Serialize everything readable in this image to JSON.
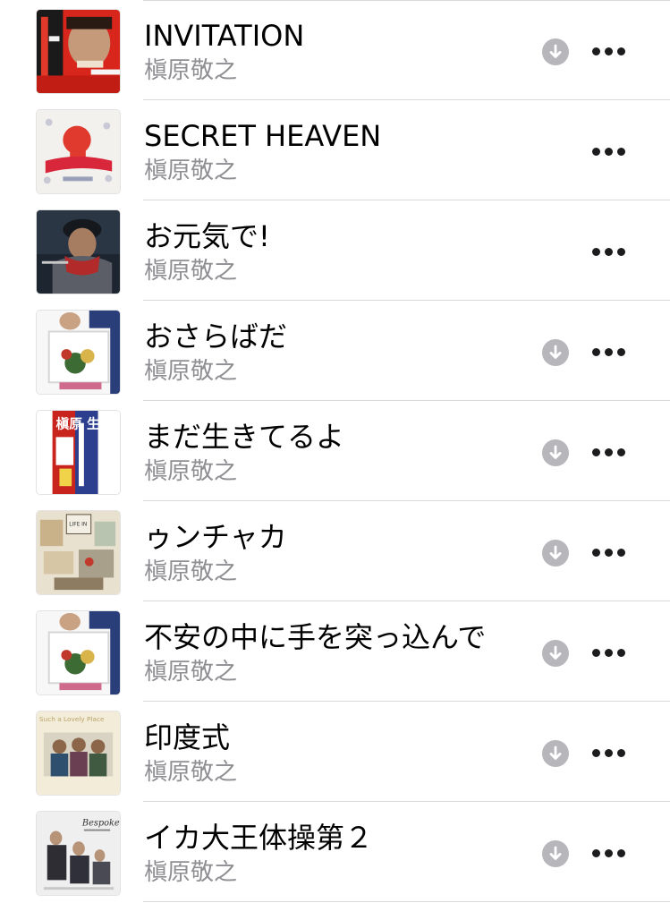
{
  "songs": [
    {
      "title": "INVITATION",
      "artist": "槇原敬之",
      "downloadable": true,
      "artwork": "artwork-invitation"
    },
    {
      "title": "SECRET HEAVEN",
      "artist": "槇原敬之",
      "downloadable": false,
      "artwork": "artwork-makihara"
    },
    {
      "title": "お元気で!",
      "artist": "槇原敬之",
      "downloadable": false,
      "artwork": "artwork-portrait"
    },
    {
      "title": "おさらばだ",
      "artist": "槇原敬之",
      "downloadable": true,
      "artwork": "artwork-box"
    },
    {
      "title": "まだ生きてるよ",
      "artist": "槇原敬之",
      "downloadable": true,
      "artwork": "artwork-banner",
      "artwork_text": "槇原 生 還"
    },
    {
      "title": "ゥンチャカ",
      "artist": "槇原敬之",
      "downloadable": true,
      "artwork": "artwork-life-in",
      "artwork_text": "LIFE IN"
    },
    {
      "title": "不安の中に手を突っ込んで",
      "artist": "槇原敬之",
      "downloadable": true,
      "artwork": "artwork-box"
    },
    {
      "title": "印度式",
      "artist": "槇原敬之",
      "downloadable": true,
      "artwork": "artwork-lovely-place",
      "artwork_text": "Such a Lovely Place"
    },
    {
      "title": "イカ大王体操第２",
      "artist": "槇原敬之",
      "downloadable": true,
      "artwork": "artwork-bespoke",
      "artwork_text": "Bespoke"
    }
  ],
  "icons": {
    "download": "download-arrow-circle-icon",
    "more": "ellipsis-icon"
  },
  "colors": {
    "title_text": "#000000",
    "subtitle_text": "#8e8e93",
    "divider": "#d9d9dc",
    "download_icon": "#b7b7bb",
    "more_icon": "#1c1c1e"
  }
}
